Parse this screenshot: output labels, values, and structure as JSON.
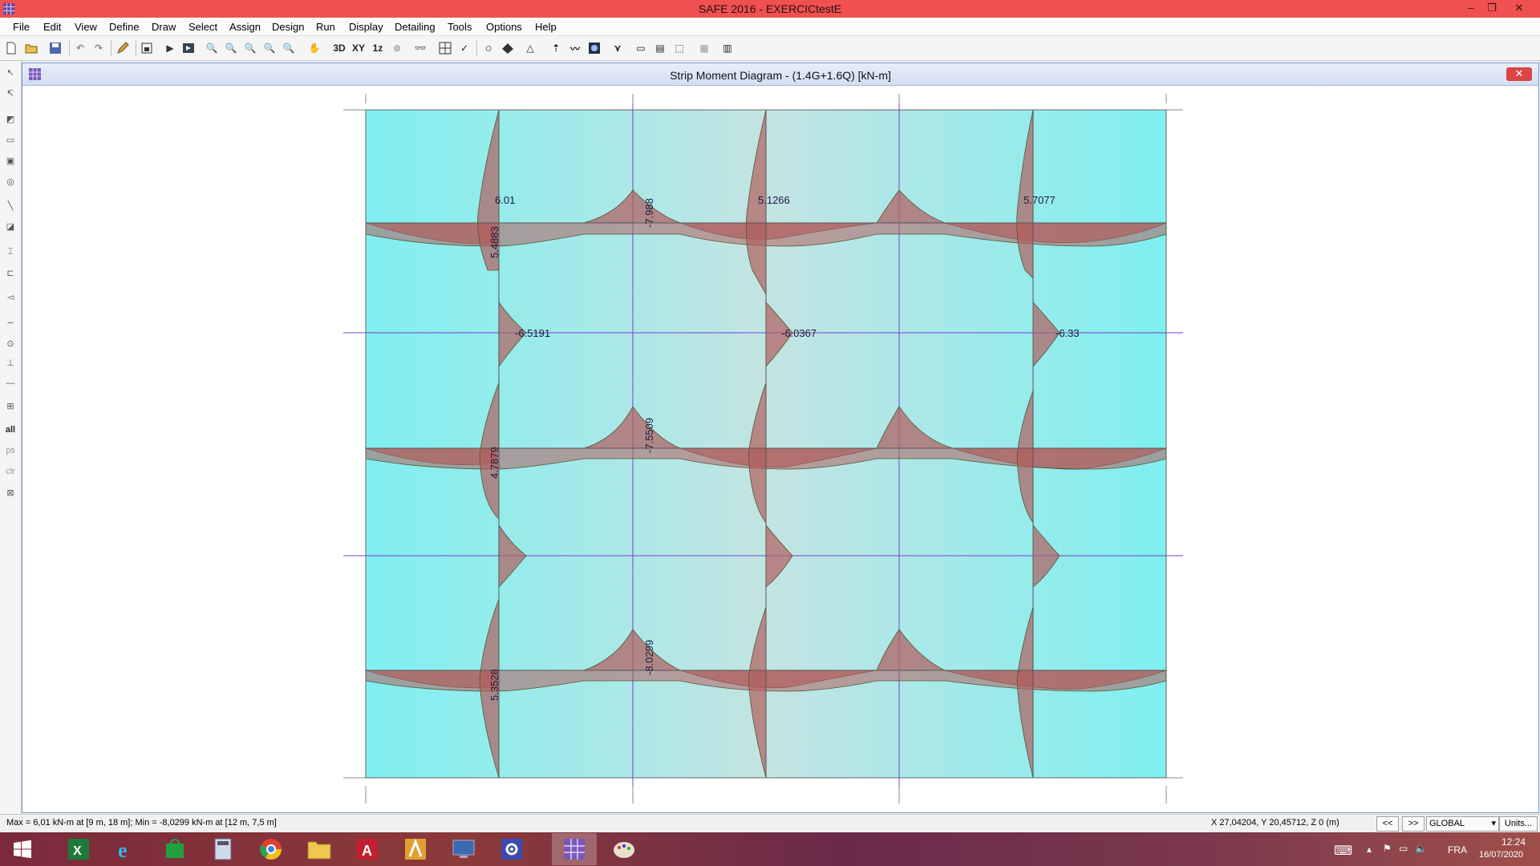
{
  "window": {
    "title": "SAFE 2016 - EXERCICtestE",
    "controls": {
      "minimize": "–",
      "restore": "❐",
      "close": "✕"
    }
  },
  "menu": [
    "File",
    "Edit",
    "View",
    "Define",
    "Draw",
    "Select",
    "Assign",
    "Design",
    "Run",
    "Display",
    "Detailing",
    "Tools",
    "Options",
    "Help"
  ],
  "toolbar": {
    "view_3d": "3D",
    "view_xy": "XY",
    "view_1z": "1z"
  },
  "left_toolbar": {
    "all": "all",
    "ps": "ps",
    "clr": "clr"
  },
  "diagram_window": {
    "title": "Strip Moment Diagram   - (1.4G+1.6Q)  [kN-m]",
    "close": "✕"
  },
  "moment_labels": {
    "l1": "6.01",
    "l2": "-7.988",
    "l3": "5.1266",
    "l4": "5.7077",
    "l5": "5.4883",
    "l6": "-6.5191",
    "l7": "-6.0367",
    "l8": "-6.33",
    "l9": "-7.5509",
    "l10": "4.7879",
    "l11": "-8.0299",
    "l12": "5.3528"
  },
  "colors": {
    "slab": "#7feff0",
    "moment_fill": "#b06060",
    "grid_line": "#7a3fd6",
    "titlebar": "#f05050"
  },
  "status": {
    "minmax": "Max = 6,01 kN-m at [9 m, 18 m];  Min = -8,0299 kN-m at [12 m, 7,5 m]",
    "coords": "X 27,04204,  Y 20,45712,  Z 0  (m)",
    "prev": "<<",
    "next": ">>",
    "coord_system": "GLOBAL",
    "units": "Units..."
  },
  "taskbar": {
    "lang": "FRA",
    "time": "12:24",
    "date": "16/07/2020"
  }
}
